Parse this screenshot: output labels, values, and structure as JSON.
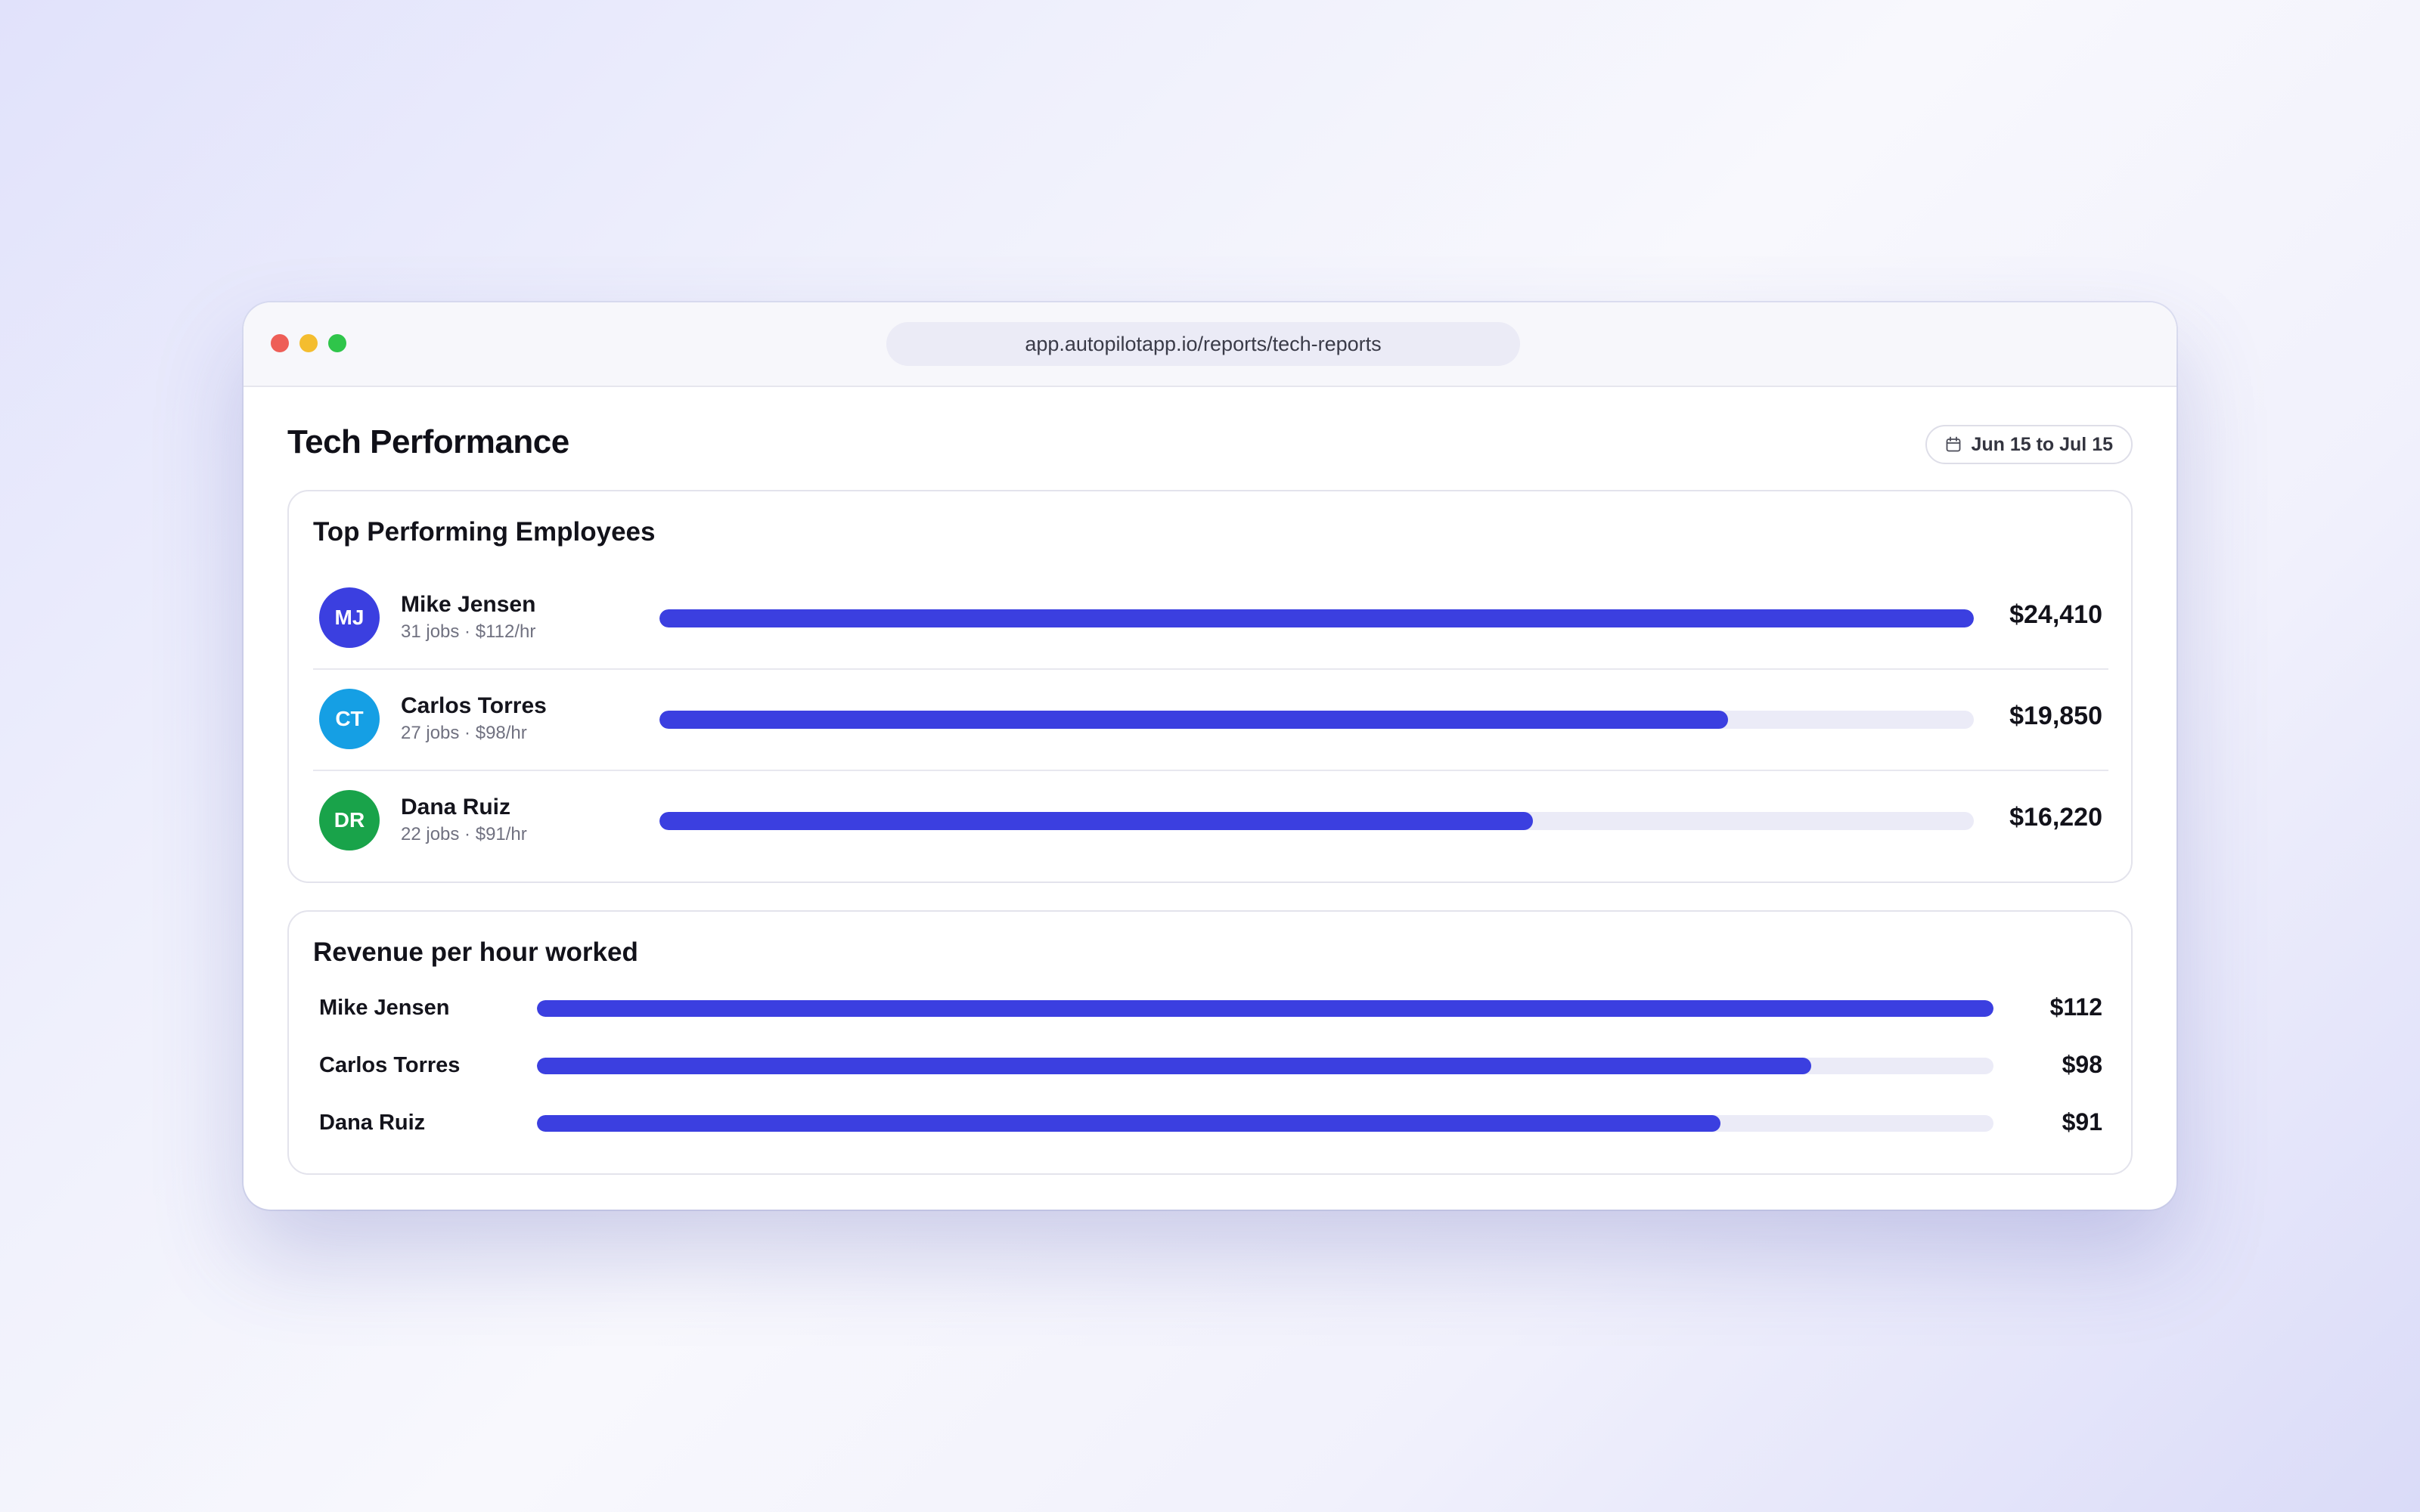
{
  "browser": {
    "url": "app.autopilotapp.io/reports/tech-reports"
  },
  "page": {
    "title": "Tech Performance",
    "date_range": "Jun 15 to Jul 15",
    "date_icon": "calendar-icon"
  },
  "colors": {
    "bar_fill": "#3b3fe0",
    "bar_track": "#ebebf7",
    "avatar_mj": "#3b3fe0",
    "avatar_ct": "#159fe4",
    "avatar_dr": "#19a34a"
  },
  "top_performers": {
    "title": "Top Performing Employees",
    "employees": [
      {
        "initials": "MJ",
        "name": "Mike Jensen",
        "meta": "31 jobs · $112/hr",
        "amount": "$24,410",
        "revenue": 24410
      },
      {
        "initials": "CT",
        "name": "Carlos Torres",
        "meta": "27 jobs · $98/hr",
        "amount": "$19,850",
        "revenue": 19850
      },
      {
        "initials": "DR",
        "name": "Dana Ruiz",
        "meta": "22 jobs · $91/hr",
        "amount": "$16,220",
        "revenue": 16220
      }
    ]
  },
  "revenue_per_hour": {
    "title": "Revenue per hour worked",
    "rows": [
      {
        "name": "Mike Jensen",
        "amount": "$112",
        "value": 112
      },
      {
        "name": "Carlos Torres",
        "amount": "$98",
        "value": 98
      },
      {
        "name": "Dana Ruiz",
        "amount": "$91",
        "value": 91
      }
    ]
  }
}
